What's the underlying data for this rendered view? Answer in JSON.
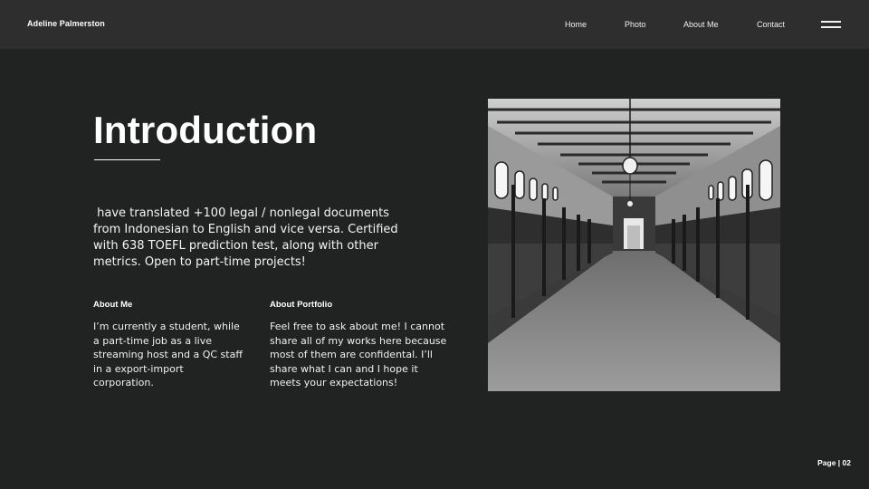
{
  "header": {
    "brand": "Adeline Palmerston",
    "nav": [
      "Home",
      "Photo",
      "About Me",
      "Contact"
    ],
    "menu_icon": "hamburger-menu-icon"
  },
  "main": {
    "title": "Introduction",
    "intro": " have translated +100 legal / nonlegal documents from Indonesian to English and vice versa. Certified with 638 TOEFL prediction test, along with other metrics. Open to part-time projects!",
    "columns": [
      {
        "heading": "About Me",
        "text": "I’m currently a student, while a part-time job as a live streaming host and a QC staff in a export-import corporation."
      },
      {
        "heading": "About Portfolio",
        "text": "Feel free to ask about me! I cannot share all of my works here because most of them are confidental. I’ll share what I can and I hope it meets your expectations!"
      }
    ]
  },
  "photo": {
    "subject": "black-and-white stable corridor"
  },
  "footer": {
    "page_label": "Page | 02"
  },
  "colors": {
    "background": "#212322",
    "header_background": "#2e2e2e",
    "text": "#ffffff"
  }
}
